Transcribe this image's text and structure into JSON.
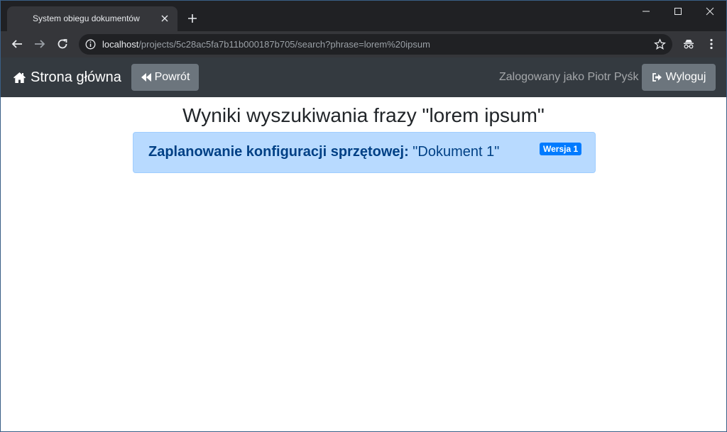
{
  "browser": {
    "tab_title": "System obiegu dokumentów",
    "url_host": "localhost",
    "url_path": "/projects/5c28ac5fa7b11b000187b705/search?phrase=lorem%20ipsum"
  },
  "navbar": {
    "brand": "Strona główna",
    "back_label": "Powrót",
    "logged_in_text": "Zalogowany jako Piotr Pyśk",
    "logout_label": "Wyloguj"
  },
  "page": {
    "heading": "Wyniki wyszukiwania frazy \"lorem ipsum\"",
    "results": [
      {
        "project": "Zaplanowanie konfiguracji sprzętowej:",
        "document": " \"Dokument 1\"",
        "version_badge": "Wersja 1"
      }
    ]
  },
  "colors": {
    "navbar_bg": "#343a40",
    "button_secondary": "#6c757d",
    "result_bg": "#b8daff",
    "result_text": "#004085",
    "badge_primary": "#007bff"
  },
  "icons": [
    "home-icon",
    "backward-icon",
    "sign-out-icon",
    "info-icon",
    "star-icon",
    "incognito-icon",
    "menu-icon"
  ]
}
